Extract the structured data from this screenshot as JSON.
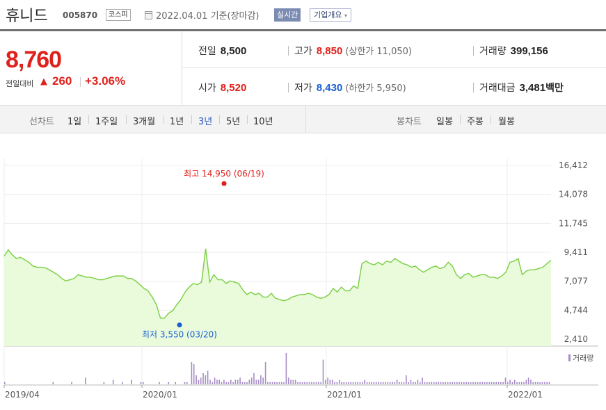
{
  "header": {
    "name": "휴니드",
    "code": "005870",
    "market": "코스피",
    "asof": "2022.04.01 기준(장마감)",
    "realtime": "실시간",
    "overview": "기업개요",
    "overview_caret": "▾"
  },
  "price": {
    "current": "8,760",
    "change_label": "전일대비",
    "arrow": "▲",
    "change": "260",
    "change_pct": "+3.06%"
  },
  "stats": {
    "prev_close": {
      "label": "전일",
      "value": "8,500"
    },
    "high": {
      "label": "고가",
      "value": "8,850",
      "sub": "(상한가 11,050)"
    },
    "volume": {
      "label": "거래량",
      "value": "399,156"
    },
    "open": {
      "label": "시가",
      "value": "8,520"
    },
    "low": {
      "label": "저가",
      "value": "8,430",
      "sub": "(하한가 5,950)"
    },
    "amount": {
      "label": "거래대금",
      "value": "3,481",
      "unit": "백만"
    }
  },
  "period": {
    "line_title": "선차트",
    "line_items": [
      "1일",
      "1주일",
      "3개월",
      "1년",
      "3년",
      "5년",
      "10년"
    ],
    "active": "3년",
    "candle_title": "봉차트",
    "candle_items": [
      "일봉",
      "주봉",
      "월봉"
    ]
  },
  "colors": {
    "up": "#e0201b",
    "down": "#1a5fd1",
    "line": "#7fd14a",
    "fill": "#eafbdc",
    "volume": "#a68cc8"
  },
  "chart_data": {
    "type": "area",
    "y_ticks": [
      "16,412",
      "14,078",
      "11,745",
      "9,411",
      "7,077",
      "4,744",
      "2,410"
    ],
    "ylim": [
      2410,
      16412
    ],
    "x_ticks": [
      "2019/04",
      "2020/01",
      "2021/01",
      "2022/01"
    ],
    "high_annotation": "최고 14,950 (06/19)",
    "low_annotation": "최저 3,550 (03/20)",
    "volume_legend": "거래량",
    "series": [
      {
        "values": [
          9100,
          9600,
          9200,
          8900,
          9000,
          8800,
          8600,
          8300,
          8200,
          8200,
          8150,
          8000,
          7800,
          7600,
          7300,
          7100,
          7200,
          7300,
          7600,
          7500,
          7400,
          7400,
          7300,
          7200,
          7200,
          7300,
          7400,
          7500,
          7500,
          7500,
          7300,
          7300,
          7100,
          6800,
          6500,
          6300,
          5800,
          5200,
          4100,
          4100,
          4500,
          4700,
          5200,
          5600,
          6200,
          6600,
          6900,
          6800,
          7000,
          9700,
          7000,
          7600,
          7200,
          7200,
          6900,
          7100,
          7000,
          6900,
          6400,
          6000,
          6200,
          6000,
          6100,
          5800,
          5800,
          6100,
          5700,
          5600,
          5500,
          5600,
          5800,
          5900,
          6000,
          6000,
          6100,
          6000,
          5800,
          5700,
          5800,
          6000,
          6500,
          6200,
          6600,
          6300,
          6300,
          6700,
          6500,
          8500,
          8700,
          8500,
          8400,
          8600,
          8400,
          8700,
          8600,
          8900,
          8700,
          8500,
          8400,
          8200,
          8300,
          8000,
          7800,
          8000,
          8200,
          8300,
          8100,
          8200,
          8600,
          8300,
          7600,
          7300,
          7600,
          7700,
          7400,
          7500,
          7600,
          7600,
          7400,
          7400,
          7300,
          7500,
          7800,
          8600,
          8700,
          8900,
          7600,
          7900,
          8000,
          8000,
          8100,
          8200,
          8500,
          8760
        ]
      }
    ],
    "volume": [
      1,
      0,
      0,
      0,
      0,
      0,
      0,
      0,
      0,
      0,
      0,
      0,
      0,
      0,
      0,
      0,
      0,
      0,
      0,
      0,
      0,
      1,
      0,
      0,
      0,
      0,
      0,
      0,
      0,
      1,
      0,
      0,
      0,
      0,
      0,
      3,
      0,
      0,
      0,
      0,
      0,
      0,
      0,
      1,
      0,
      0,
      0,
      2,
      0,
      0,
      0,
      1,
      0,
      0,
      0,
      2,
      0,
      0,
      0,
      1,
      1,
      0,
      0,
      0,
      0,
      0,
      0,
      1,
      0,
      0,
      0,
      1,
      0,
      0,
      1,
      0,
      0,
      0,
      1,
      1,
      0,
      10,
      9,
      4,
      2,
      3,
      5,
      4,
      6,
      2,
      1,
      3,
      2,
      2,
      1,
      2,
      1,
      1,
      2,
      1,
      2,
      2,
      3,
      1,
      1,
      1,
      2,
      3,
      5,
      2,
      2,
      4,
      3,
      10,
      1,
      1,
      1,
      1,
      1,
      1,
      1,
      1,
      14,
      3,
      2,
      2,
      2,
      1,
      1,
      1,
      1,
      1,
      1,
      1,
      1,
      1,
      1,
      1,
      11,
      2,
      3,
      2,
      2,
      1,
      1,
      2,
      1,
      1,
      1,
      1,
      1,
      1,
      1,
      1,
      1,
      1,
      2,
      1,
      1,
      1,
      1,
      1,
      1,
      1,
      1,
      1,
      1,
      1,
      1,
      1,
      2,
      1,
      1,
      1,
      4,
      1,
      2,
      1,
      1,
      2,
      1,
      3,
      1,
      1,
      1,
      1,
      1,
      1,
      1,
      1,
      1,
      1,
      1,
      1,
      1,
      1,
      1,
      1,
      1,
      1,
      1,
      1,
      1,
      1,
      1,
      1,
      1,
      1,
      1,
      1,
      1,
      1,
      1,
      1,
      1,
      1,
      1,
      3,
      1,
      2,
      1,
      2,
      1,
      1,
      1,
      1,
      2,
      3,
      2,
      1,
      1,
      1,
      1,
      1,
      1,
      1,
      1
    ]
  }
}
